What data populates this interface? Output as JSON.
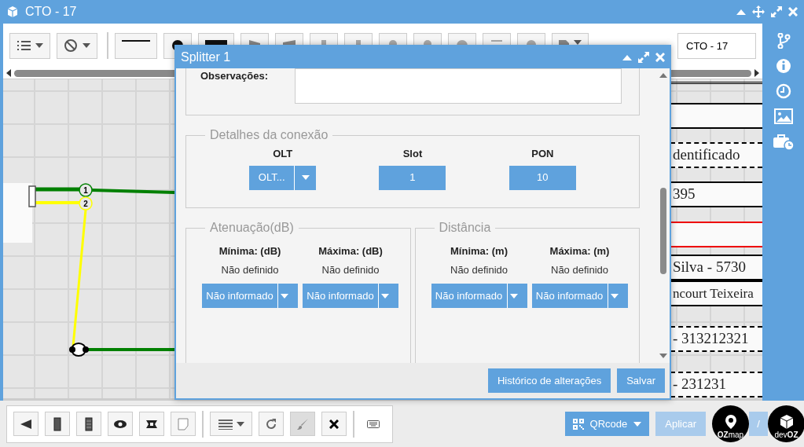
{
  "window": {
    "title": "CTO - 17"
  },
  "toolbar": {
    "name_field": {
      "value": "CTO - 17"
    }
  },
  "diagram": {
    "ports": [
      {
        "label": "1",
        "color": "#008000"
      },
      {
        "label": "2",
        "color": "#ffff00"
      }
    ]
  },
  "canvas_rows": [
    {
      "kind": "solid"
    },
    {
      "text": "dentificado",
      "kind": "dashed"
    },
    {
      "text": "395",
      "kind": "solid"
    },
    {
      "kind": "red"
    },
    {
      "text": "Silva - 5730",
      "kind": "solid"
    },
    {
      "text": "ncourt Teixeira",
      "kind": "solid"
    },
    {
      "text": "- 313212321",
      "kind": "dashed"
    },
    {
      "text": "- 231231",
      "kind": "dashed"
    }
  ],
  "dialog": {
    "title": "Splitter 1",
    "observations": {
      "label": "Observações:"
    },
    "connection": {
      "legend": "Detalhes da conexão",
      "fields": [
        {
          "label": "OLT",
          "value": "OLT...",
          "kind": "dropdown"
        },
        {
          "label": "Slot",
          "value": "1",
          "kind": "button"
        },
        {
          "label": "PON",
          "value": "10",
          "kind": "button"
        }
      ]
    },
    "groups": [
      {
        "legend": "Atenuação(dB)",
        "columns": [
          {
            "label": "Mínima: (dB)",
            "value": "Não definido",
            "button": "Não informado"
          },
          {
            "label": "Máxima: (dB)",
            "value": "Não definido",
            "button": "Não informado"
          }
        ]
      },
      {
        "legend": "Distância",
        "columns": [
          {
            "label": "Mínima: (m)",
            "value": "Não definido",
            "button": "Não informado"
          },
          {
            "label": "Máxima: (m)",
            "value": "Não definido",
            "button": "Não informado"
          }
        ]
      }
    ],
    "buttons": [
      "Histórico de alterações",
      "Salvar"
    ]
  },
  "bottom_bar": {
    "qrcode": "QRcode",
    "apply": {
      "label": "Aplicar",
      "disabled": true
    },
    "extra_button": "/",
    "logos": [
      "**OZ**map",
      "dev**OZ**"
    ]
  }
}
